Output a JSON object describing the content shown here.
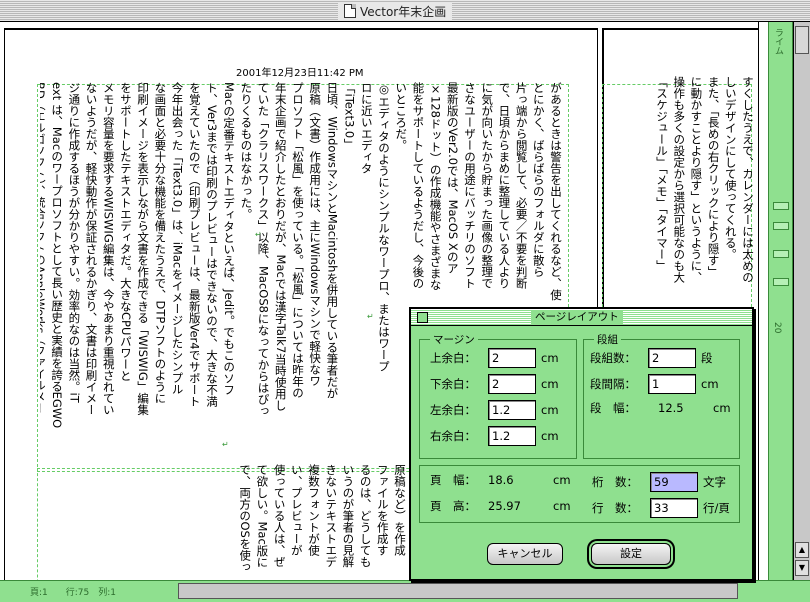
{
  "window": {
    "title": "Vector年末企画"
  },
  "document": {
    "date": "2001年12月23日11:42 PM",
    "main_columns_text": "があるときは警告を出してくれるなど、使\nとにかく、ばらばらのフォルダに散ら\n片っ端から閲覧して、必要／不要を判断\nで、日頃からまめに整理している人より\nに気が向いたから貯まった画像の整理で\nさなユーザーの用途にバッチリのソフト\n最新版のVer2.0では、MacOS Xのア\n×128ドット）の作成機能やさまざまな\n能をサポートしているようだし、今後の\nいところだ。\n◎エディタのようにシンプルなワープロ、またはワープ\nロに近いエディタ\n「iText3.0」\n日頃、WindowsマシンとMacintoshを併用している筆者だが\n原稿（文書）作成用には、主にWindowsマシンで軽快なワ\nプロソフト「松風」を使っている。「松風」については昨年の\n年末企画で紹介したとおりだが、Macでは漢字Talk7当時使用し\nていた「クラリスワークス」以降、MacOS8になってからはぴっ\nたりくるものはなかった。\nMacの定番テキストエディタといえば、Jedit。でもこのソフ\nト、Ver3までは印刷のプレビューはできないので、大きな不満\nを覚えていたので（印刷プレビューは、最新版Ver4でサポート\n今年出会った「iText3.0」は、iMacをイメージしたシンプル\nな画面と必要十分な機能を備えたうえで、DTPソフトのように\n印刷イメージを表示しながら文書を作成できる「WISWIG」編集\nをサポートしたテキストエディタだ。大きなCPUパワーと\nメモリ容量を要求するWISWIG編集は、今やあまり重視されてい\nないようだが、軽快動作が保証されるかぎり、文書は印刷イメー\nジ通りに作成するほうが分かりやすい。効率的なのは当然。iT\next は、Macのワープロソフトとして長い歴史と実績を誇るEGWO\nRD（エルゴソフト）、統合ソフトのAppleWorks（ファイルメー",
    "right_page_text": "すくしたうえで、カレンダーには太めの\nしいデザインにして使ってくれる。\nまた、「長めの右クリックにより隠す」\nに動かすことより隠す」というように、\n操作も多くの設定から選択可能なのも大\n「スケジュール」「メモ」「タイマー」",
    "bottom_text": "原稿など）を作成\nファイルを作成す\nるのは、どうしても\nいうのが筆者の見解\nきないテキストエデ\n複数フォントが使\nい、プレビューが\n使っている人は、ぜ\nて欲しい。Mac版に\nで、両方のOSを使っ"
  },
  "ruler": {
    "label_top": "ライム",
    "label_mid": "20"
  },
  "status": {
    "text": "頁:1　　行:75　列:1"
  },
  "dialog": {
    "title": "ページレイアウト",
    "margin_group": "マージン",
    "margin_top_label": "上余白：",
    "margin_top_value": "2",
    "margin_bottom_label": "下余白：",
    "margin_bottom_value": "2",
    "margin_left_label": "左余白：",
    "margin_left_value": "1.2",
    "margin_right_label": "右余白：",
    "margin_right_value": "1.2",
    "unit_cm": "cm",
    "columns_group": "段組",
    "columns_count_label": "段組数：",
    "columns_count_value": "2",
    "columns_count_unit": "段",
    "columns_gap_label": "段間隔：",
    "columns_gap_value": "1",
    "columns_width_label": "段　幅：",
    "columns_width_value": "12.5",
    "page_width_label": "頁　幅：",
    "page_width_value": "18.6",
    "page_height_label": "頁　高：",
    "page_height_value": "25.97",
    "digits_label": "桁　数：",
    "digits_value": "59",
    "digits_unit": "文字",
    "lines_label": "行　数：",
    "lines_value": "33",
    "lines_unit": "行/頁",
    "cancel_label": "キャンセル",
    "ok_label": "設定"
  }
}
